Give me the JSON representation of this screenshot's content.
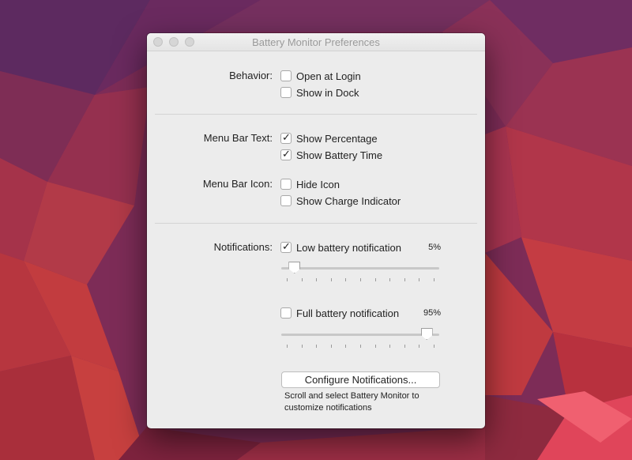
{
  "window": {
    "title": "Battery Monitor Preferences"
  },
  "behavior": {
    "label": "Behavior:",
    "options": [
      {
        "label": "Open at Login",
        "checked": false
      },
      {
        "label": "Show in Dock",
        "checked": false
      }
    ]
  },
  "menu_bar_text": {
    "label": "Menu Bar Text:",
    "options": [
      {
        "label": "Show Percentage",
        "checked": true
      },
      {
        "label": "Show Battery Time",
        "checked": true
      }
    ]
  },
  "menu_bar_icon": {
    "label": "Menu Bar Icon:",
    "options": [
      {
        "label": "Hide Icon",
        "checked": false
      },
      {
        "label": "Show Charge Indicator",
        "checked": false
      }
    ]
  },
  "notifications": {
    "label": "Notifications:",
    "low": {
      "label": "Low battery notification",
      "checked": true,
      "value_text": "5%",
      "value": 5
    },
    "full": {
      "label": "Full battery notification",
      "checked": false,
      "value_text": "95%",
      "value": 95
    }
  },
  "configure": {
    "button_label": "Configure Notifications...",
    "hint": "Scroll and select Battery Monitor to customize notifications"
  },
  "icons": {
    "check": "✓"
  }
}
